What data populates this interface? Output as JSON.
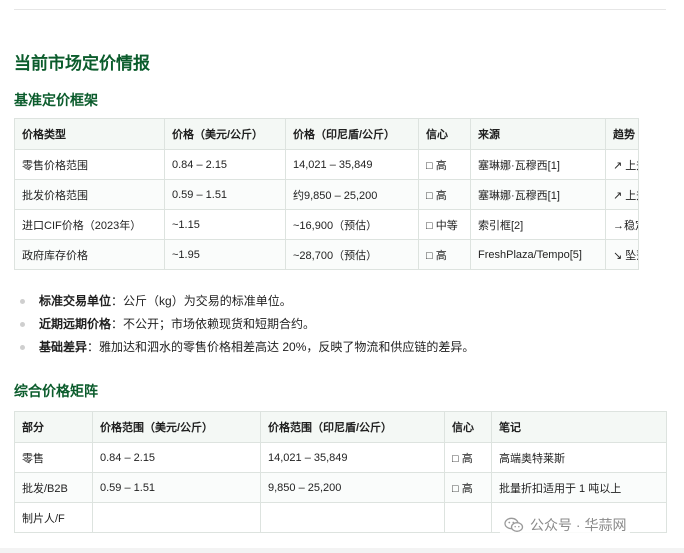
{
  "main_title": "当前市场定价情报",
  "section1": {
    "title": "基准定价框架",
    "headers": [
      "价格类型",
      "价格（美元/公斤）",
      "价格（印尼盾/公斤）",
      "信心",
      "来源",
      "趋势"
    ],
    "rows": [
      [
        "零售价格范围",
        "0.84 – 2.15",
        "14,021 – 35,849",
        "□ 高",
        "塞琳娜·瓦穆西[1]",
        "↗ 上升"
      ],
      [
        "批发价格范围",
        "0.59 – 1.51",
        "约9,850 – 25,200",
        "□ 高",
        "塞琳娜·瓦穆西[1]",
        "↗ 上升"
      ],
      [
        "进口CIF价格（2023年）",
        "~1.15",
        "~16,900（预估）",
        "□ 中等",
        "索引框[2]",
        "→稳定"
      ],
      [
        "政府库存价格",
        "~1.95",
        "~28,700（预估）",
        "□ 高",
        "FreshPlaza/Tempo[5]",
        "↘ 坠落"
      ]
    ]
  },
  "bullets": [
    {
      "label": "标准交易单位",
      "text": "：公斤（kg）为交易的标准单位。"
    },
    {
      "label": "近期远期价格",
      "text": "：不公开；市场依赖现货和短期合约。"
    },
    {
      "label": "基础差异",
      "text": "：雅加达和泗水的零售价格相差高达 20%，反映了物流和供应链的差异。"
    }
  ],
  "section2": {
    "title": "综合价格矩阵",
    "headers": [
      "部分",
      "价格范围（美元/公斤）",
      "价格范围（印尼盾/公斤）",
      "信心",
      "笔记"
    ],
    "rows": [
      [
        "零售",
        "0.84 – 2.15",
        "14,021 – 35,849",
        "□ 高",
        "高端奥特莱斯"
      ],
      [
        "批发/B2B",
        "0.59 – 1.51",
        "9,850 – 25,200",
        "□ 高",
        "批量折扣适用于 1 吨以上"
      ],
      [
        "制片人/F",
        "",
        "",
        "",
        ""
      ]
    ]
  },
  "watermark": {
    "text": "公众号 · 华蒜网",
    "icon": "wechat-icon"
  }
}
